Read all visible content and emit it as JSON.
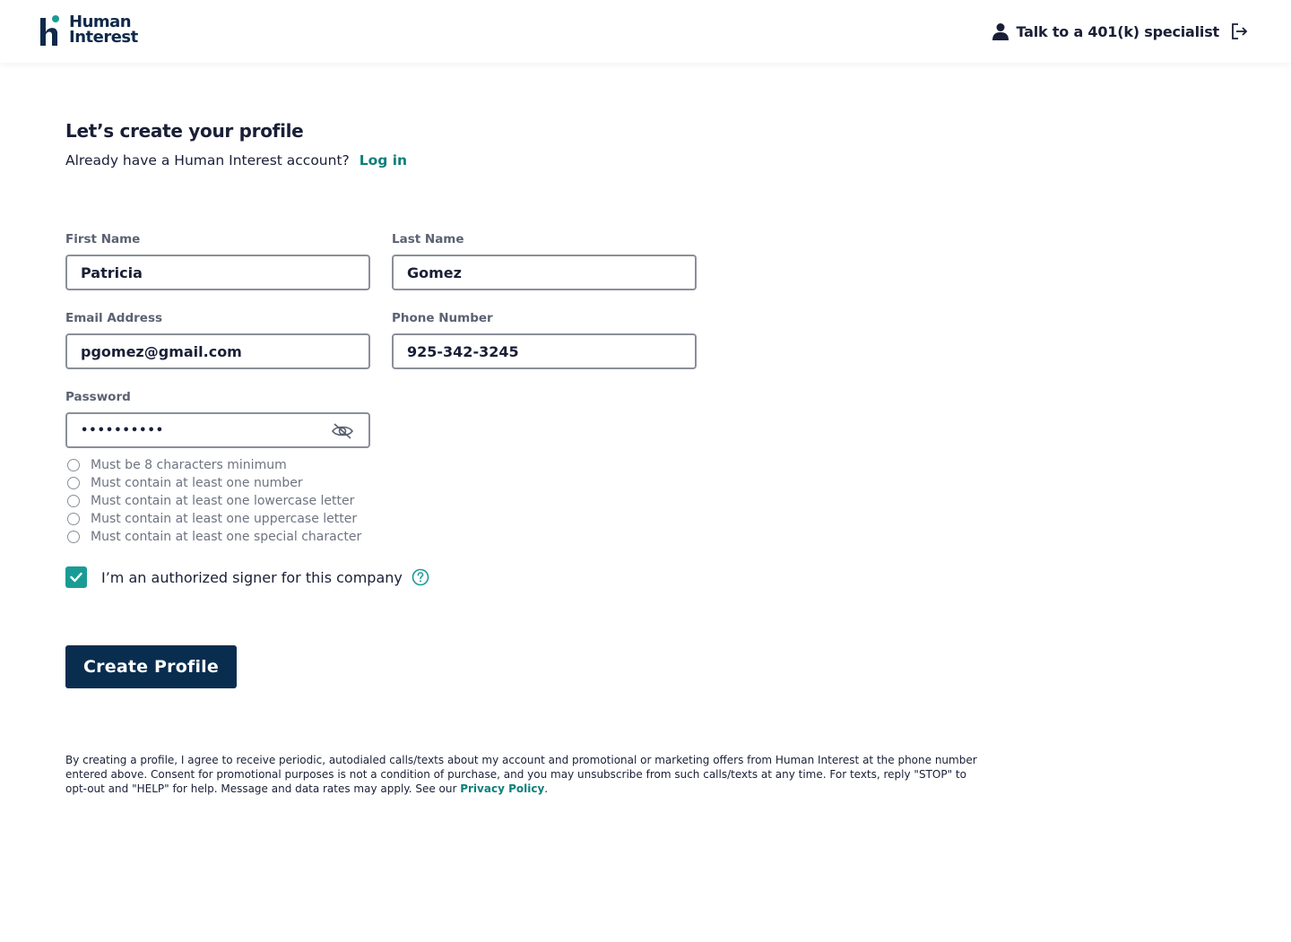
{
  "brand": {
    "line1": "Human",
    "line2": "Interest",
    "accent_color": "#1a9c96",
    "navy_color": "#0f2a4a"
  },
  "header": {
    "specialist_label": "Talk to a 401(k) specialist",
    "person_icon": "person-icon",
    "logout_icon": "logout-icon"
  },
  "main": {
    "title": "Let’s create your profile",
    "subtitle": "Already have a Human Interest account?",
    "login_link": "Log in"
  },
  "form": {
    "first_name": {
      "label": "First Name",
      "value": "Patricia"
    },
    "last_name": {
      "label": "Last Name",
      "value": "Gomez"
    },
    "email": {
      "label": "Email Address",
      "value": "pgomez@gmail.com"
    },
    "phone": {
      "label": "Phone Number",
      "value": "925-342-3245"
    },
    "password": {
      "label": "Password",
      "value": "••••••••••",
      "toggle_icon": "eye-off-icon"
    },
    "rules": [
      "Must be 8 characters minimum",
      "Must contain at least one number",
      "Must contain at least one lowercase letter",
      "Must contain at least one uppercase letter",
      "Must contain at least one special character"
    ],
    "signer": {
      "label": "I’m an authorized signer for this company",
      "checked": true,
      "help_icon": "question-circle-icon"
    },
    "submit_label": "Create Profile"
  },
  "disclaimer": {
    "text": "By creating a profile, I agree to receive periodic, autodialed calls/texts about my account and promotional or marketing offers from Human Interest at the phone number entered above. Consent for promotional purposes is not a condition of purchase, and you may unsubscribe from such calls/texts at any time. For texts, reply \"STOP\" to opt-out and \"HELP\" for help. Message and data rates may apply. See our ",
    "link": "Privacy Policy",
    "end": "."
  }
}
